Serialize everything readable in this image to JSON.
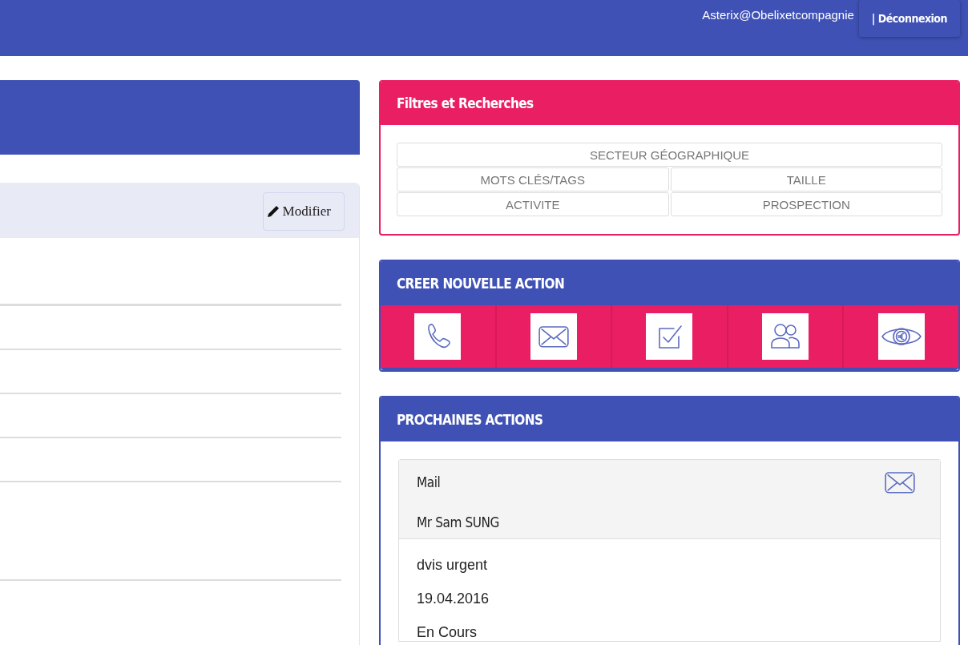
{
  "header": {
    "user": "Asterix@Obelixetcompagnie",
    "logout": "| Déconnexion"
  },
  "detail_card": {
    "edit_button": "Modifier"
  },
  "filters": {
    "title": "Filtres et Recherches",
    "rows": [
      [
        "SECTEUR GÉOGRAPHIQUE"
      ],
      [
        "MOTS CLÉS/TAGS",
        "TAILLE"
      ],
      [
        "ACTIVITE",
        "PROSPECTION"
      ]
    ]
  },
  "new_action": {
    "title": "CREER NOUVELLE ACTION",
    "actions": [
      {
        "kind": "phone"
      },
      {
        "kind": "mail"
      },
      {
        "kind": "task"
      },
      {
        "kind": "meeting"
      },
      {
        "kind": "eye"
      }
    ]
  },
  "next_actions": {
    "title": "PROCHAINES ACTIONS",
    "items": [
      {
        "kind": "mail",
        "type": "Mail",
        "contact": "Mr Sam SUNG",
        "lines": [
          "dvis urgent",
          "19.04.2016",
          "En Cours"
        ]
      }
    ]
  }
}
